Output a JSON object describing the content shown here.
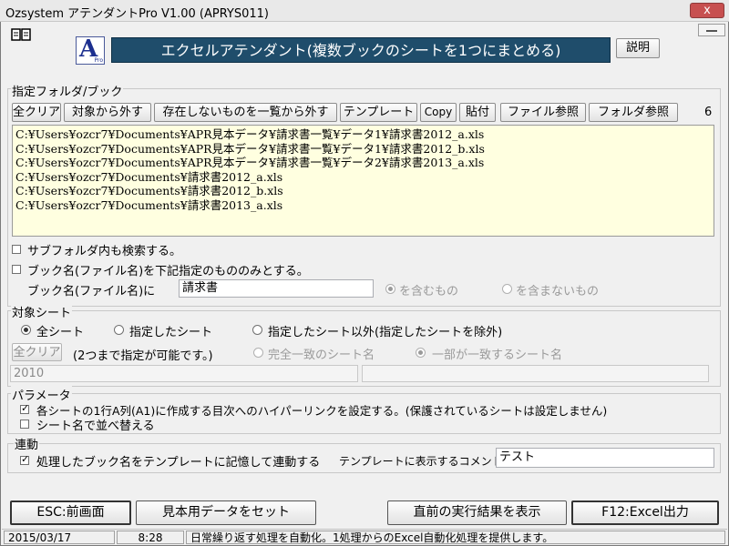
{
  "window": {
    "title": "Ozsystem アテンダントPro V1.00 (APRYS011)",
    "close_label": "x"
  },
  "header": {
    "logo_letter": "A",
    "logo_small": "Pro",
    "banner": "エクセルアテンダント(複数ブックのシートを1つにまとめる)",
    "help_button": "説明"
  },
  "folder_group": {
    "label": "指定フォルダ/ブック",
    "buttons": [
      "全クリア",
      "対象から外す",
      "存在しないものを一覧から外す",
      "テンプレート",
      "Copy",
      "貼付",
      "ファイル参照",
      "フォルダ参照"
    ],
    "count": "6",
    "files": [
      "C:¥Users¥ozcr7¥Documents¥APR見本データ¥請求書一覧¥データ1¥請求書2012_a.xls",
      "C:¥Users¥ozcr7¥Documents¥APR見本データ¥請求書一覧¥データ1¥請求書2012_b.xls",
      "C:¥Users¥ozcr7¥Documents¥APR見本データ¥請求書一覧¥データ2¥請求書2013_a.xls",
      "C:¥Users¥ozcr7¥Documents¥請求書2012_a.xls",
      "C:¥Users¥ozcr7¥Documents¥請求書2012_b.xls",
      "C:¥Users¥ozcr7¥Documents¥請求書2013_a.xls"
    ],
    "subfolder_option": "サブフォルダ内も検索する。",
    "bookname_option": "ブック名(ファイル名)を下記指定のもののみとする。",
    "bookname_label": "ブック名(ファイル名)に",
    "bookname_value": "請求書",
    "include_label": "を含むもの",
    "exclude_label": "を含まないもの"
  },
  "sheet_group": {
    "label": "対象シート",
    "all": "全シート",
    "specified": "指定したシート",
    "except": "指定したシート以外(指定したシートを除外)",
    "clear_button": "全クリア",
    "hint": "(2つまで指定が可能です。)",
    "exact": "完全一致のシート名",
    "partial": "一部が一致するシート名",
    "sheet1_value": "2010",
    "sheet2_value": ""
  },
  "param_group": {
    "label": "パラメータ",
    "hyperlink_option": "各シートの1行A列(A1)に作成する目次へのハイパーリンクを設定する。(保護されているシートは設定しません)",
    "sort_option": "シート名で並べ替える"
  },
  "link_group": {
    "label": "連動",
    "remember_option": "処理したブック名をテンプレートに記憶して連動する",
    "comment_label": "テンプレートに表示するコメント",
    "comment_value": "テスト"
  },
  "footer": {
    "esc_button": "ESC:前画面",
    "sample_button": "見本用データをセット",
    "last_result_button": "直前の実行結果を表示",
    "excel_button": "F12:Excel出力"
  },
  "status": {
    "date": "2015/03/17",
    "time": "8:28",
    "message": "日常繰り返す処理を自動化。1処理からのExcel自動化処理を提供します。"
  },
  "colors": {
    "banner_bg": "#1f4d6b",
    "list_bg": "#ffffe0",
    "close_bg": "#c75050"
  }
}
